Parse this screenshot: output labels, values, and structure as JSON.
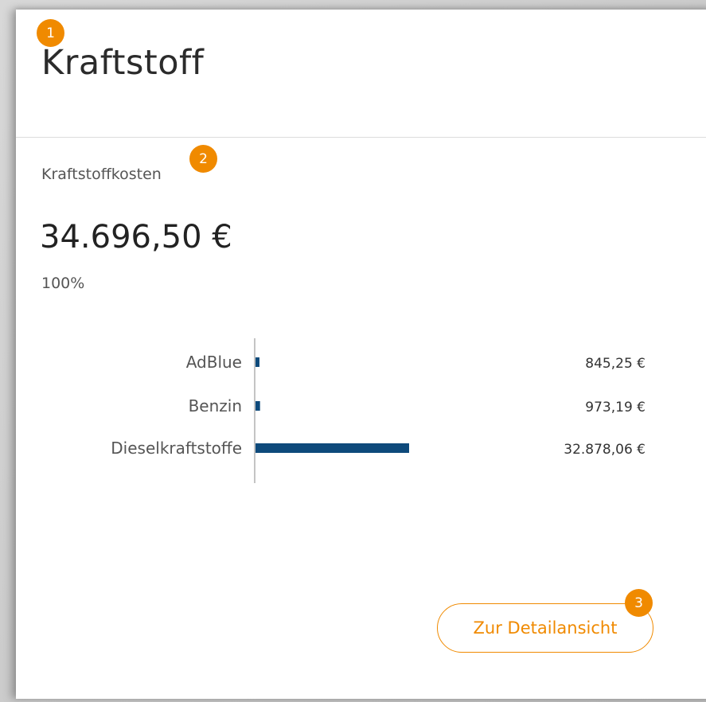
{
  "card": {
    "title": "Kraftstoff",
    "badges": [
      "1",
      "2",
      "3"
    ]
  },
  "kpi": {
    "label": "Kraftstoffkosten",
    "value": "34.696,50 €",
    "percent": "100%"
  },
  "chart_data": {
    "type": "bar",
    "orientation": "horizontal",
    "categories": [
      "AdBlue",
      "Benzin",
      "Dieselkraftstoffe"
    ],
    "values": [
      845.25,
      973.19,
      32878.06
    ],
    "value_labels": [
      "845,25 €",
      "973,19 €",
      "32.878,06 €"
    ],
    "bar_color": "#0e4a7b"
  },
  "actions": {
    "detail_label": "Zur Detailansicht"
  },
  "colors": {
    "accent": "#f08a00",
    "bar": "#0e4a7b"
  }
}
